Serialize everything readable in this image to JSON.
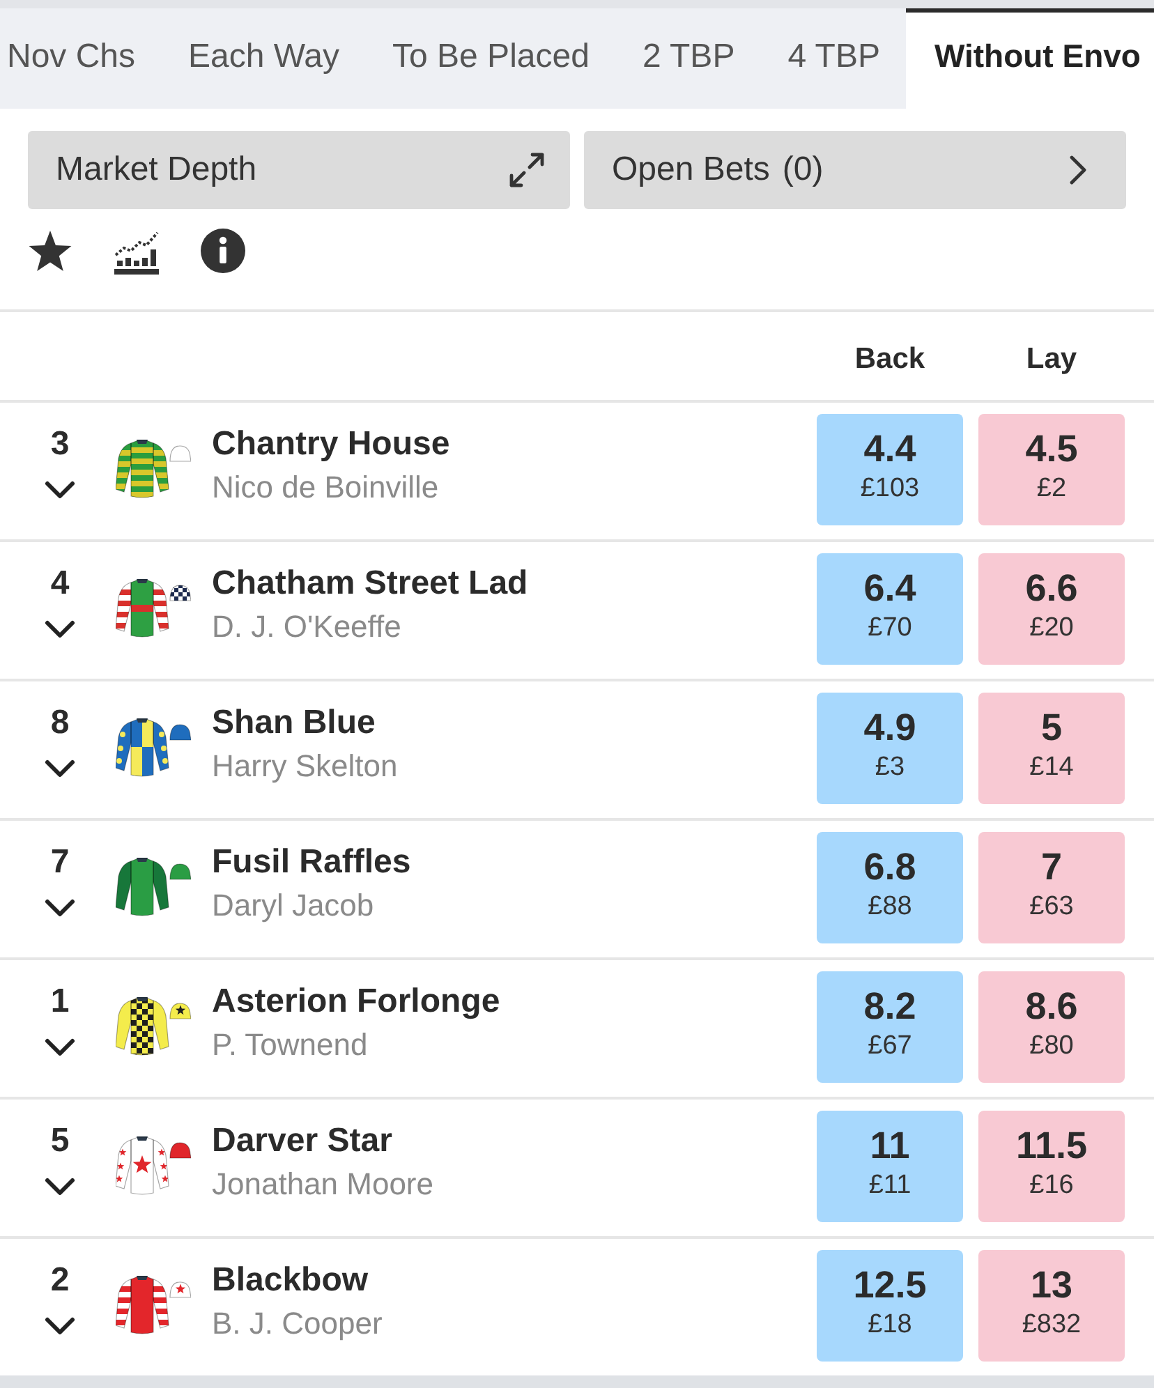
{
  "tabs": [
    {
      "label": "Nov Chs",
      "selected": false
    },
    {
      "label": "Each Way",
      "selected": false
    },
    {
      "label": "To Be Placed",
      "selected": false
    },
    {
      "label": "2 TBP",
      "selected": false
    },
    {
      "label": "4 TBP",
      "selected": false
    },
    {
      "label": "Without Envo",
      "selected": true
    }
  ],
  "market_depth_button": {
    "label": "Market Depth"
  },
  "open_bets_button": {
    "label": "Open Bets",
    "count": "(0)"
  },
  "table": {
    "columns": [
      {
        "label": "Back"
      },
      {
        "label": "Lay"
      }
    ]
  },
  "runners": [
    {
      "number": "3",
      "expanded": false,
      "name": "Chantry House",
      "jockey": "Nico de Boinville",
      "silk": {
        "body": {
          "color": "#2a9d3e",
          "kind": "hoops",
          "pattern": {
            "color": "#d8c72b"
          }
        },
        "sleeves": {
          "color": "#2a9d3e",
          "kind": "hoops",
          "pattern": {
            "color": "#d8c72b"
          }
        },
        "cap": {
          "color": "#ffffff"
        }
      },
      "back": {
        "price": "4.4",
        "amount": "£103"
      },
      "lay": {
        "price": "4.5",
        "amount": "£2"
      }
    },
    {
      "number": "4",
      "expanded": false,
      "name": "Chatham Street Lad",
      "jockey": "D. J. O'Keeffe",
      "silk": {
        "body": {
          "color": "#2ea043",
          "kind": "band",
          "pattern": {
            "color": "#d9302c"
          }
        },
        "sleeves": {
          "color": "#ffffff",
          "kind": "hoops",
          "pattern": {
            "color": "#d9302c"
          }
        },
        "cap": {
          "color": "#ffffff",
          "kind": "check",
          "pattern": {
            "color": "#1d2b4f"
          }
        }
      },
      "back": {
        "price": "6.4",
        "amount": "£70"
      },
      "lay": {
        "price": "6.6",
        "amount": "£20"
      }
    },
    {
      "number": "8",
      "expanded": false,
      "name": "Shan Blue",
      "jockey": "Harry Skelton",
      "silk": {
        "body": {
          "color": "#1f6dbd",
          "kind": "quartered",
          "pattern": {
            "color": "#f5ea5a"
          }
        },
        "sleeves": {
          "color": "#1f6dbd",
          "kind": "spots",
          "pattern": {
            "color": "#f5ea5a"
          }
        },
        "cap": {
          "color": "#1f6dbd"
        }
      },
      "back": {
        "price": "4.9",
        "amount": "£3"
      },
      "lay": {
        "price": "5",
        "amount": "£14"
      }
    },
    {
      "number": "7",
      "expanded": false,
      "name": "Fusil Raffles",
      "jockey": "Daryl Jacob",
      "silk": {
        "body": {
          "color": "#2a9d44"
        },
        "sleeves": {
          "color": "#17773a"
        },
        "cap": {
          "color": "#2a9d44"
        }
      },
      "back": {
        "price": "6.8",
        "amount": "£88"
      },
      "lay": {
        "price": "7",
        "amount": "£63"
      }
    },
    {
      "number": "1",
      "expanded": false,
      "name": "Asterion Forlonge",
      "jockey": "P. Townend",
      "silk": {
        "body": {
          "color": "#f4ec4c",
          "kind": "check",
          "pattern": {
            "color": "#1f1f1f"
          }
        },
        "sleeves": {
          "color": "#f4ec4c"
        },
        "cap": {
          "color": "#f4ec4c",
          "kind": "star",
          "pattern": {
            "color": "#1f1f1f"
          }
        }
      },
      "back": {
        "price": "8.2",
        "amount": "£67"
      },
      "lay": {
        "price": "8.6",
        "amount": "£80"
      }
    },
    {
      "number": "5",
      "expanded": false,
      "name": "Darver Star",
      "jockey": "Jonathan Moore",
      "silk": {
        "body": {
          "color": "#ffffff",
          "kind": "star",
          "pattern": {
            "color": "#e0262b"
          }
        },
        "sleeves": {
          "color": "#ffffff",
          "kind": "stars",
          "pattern": {
            "color": "#e0262b"
          }
        },
        "cap": {
          "color": "#e0262b"
        }
      },
      "back": {
        "price": "11",
        "amount": "£11"
      },
      "lay": {
        "price": "11.5",
        "amount": "£16"
      }
    },
    {
      "number": "2",
      "expanded": false,
      "name": "Blackbow",
      "jockey": "B. J. Cooper",
      "silk": {
        "body": {
          "color": "#e3262b"
        },
        "sleeves": {
          "color": "#ffffff",
          "kind": "hoops",
          "pattern": {
            "color": "#e3262b"
          }
        },
        "cap": {
          "color": "#ffffff",
          "kind": "star",
          "pattern": {
            "color": "#e3262b"
          }
        }
      },
      "back": {
        "price": "12.5",
        "amount": "£18"
      },
      "lay": {
        "price": "13",
        "amount": "£832"
      }
    }
  ]
}
